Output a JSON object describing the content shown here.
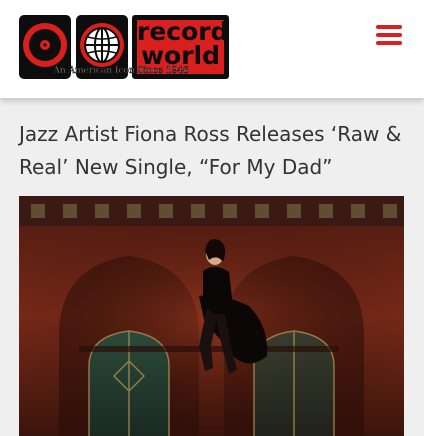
{
  "site": {
    "logo_word_line1": "record",
    "logo_word_line2": "world",
    "tagline": "An American Icon Since 1946"
  },
  "colors": {
    "brand_red": "#d9201f",
    "header_bg": "#ffffff",
    "page_bg": "#efefef",
    "title_text": "#333333"
  },
  "icons": {
    "menu": "hamburger-menu-icon",
    "logo_record": "vinyl-record-icon",
    "logo_globe": "globe-icon"
  },
  "article": {
    "title": "Jazz Artist Fiona Ross Releases ‘Raw & Real’ New Single, “For My Dad”"
  }
}
